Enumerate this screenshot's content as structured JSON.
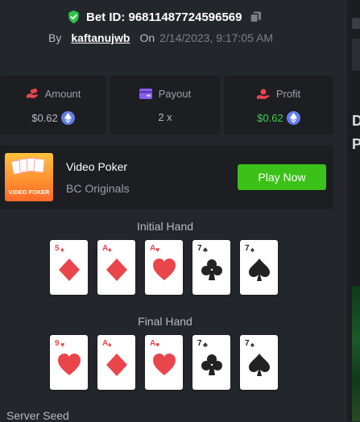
{
  "header": {
    "bet_id": "Bet ID: 96811487724596569",
    "by_label": "By",
    "username": "kaftanujwb",
    "on_label": "On",
    "date": "2/14/2023, 9:17:05 AM"
  },
  "stats": {
    "amount": {
      "label": "Amount",
      "value": "$0.62",
      "icon": "eth-icon"
    },
    "payout": {
      "label": "Payout",
      "value": "2 x"
    },
    "profit": {
      "label": "Profit",
      "value": "$0.62",
      "icon": "eth-icon",
      "color": "#3bd24a"
    }
  },
  "game": {
    "name": "Video Poker",
    "provider": "BC Originals",
    "thumb_label": "VIDEO POKER",
    "play_label": "Play Now",
    "play_color": "#3bc117"
  },
  "initial_hand": {
    "title": "Initial Hand",
    "cards": [
      {
        "rank": "5",
        "suit": "diamond"
      },
      {
        "rank": "A",
        "suit": "diamond"
      },
      {
        "rank": "A",
        "suit": "heart"
      },
      {
        "rank": "7",
        "suit": "club"
      },
      {
        "rank": "7",
        "suit": "spade"
      }
    ]
  },
  "final_hand": {
    "title": "Final Hand",
    "cards": [
      {
        "rank": "9",
        "suit": "heart"
      },
      {
        "rank": "A",
        "suit": "diamond"
      },
      {
        "rank": "A",
        "suit": "heart"
      },
      {
        "rank": "7",
        "suit": "club"
      },
      {
        "rank": "7",
        "suit": "spade"
      }
    ]
  },
  "server_seed": {
    "label": "Server Seed"
  },
  "right_edge": {
    "glyph_1": "D",
    "glyph_2": "P"
  }
}
